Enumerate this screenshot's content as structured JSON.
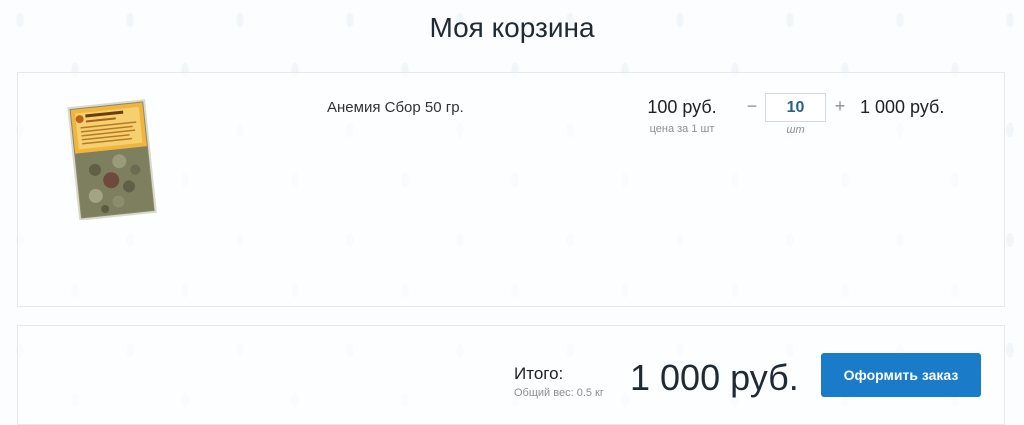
{
  "page": {
    "title": "Моя корзина"
  },
  "cart": {
    "items": [
      {
        "image_alt": "Анемия Сбор",
        "name": "Анемия Сбор 50 гр.",
        "unit_price": "100 руб.",
        "unit_price_caption": "цена за 1 шт",
        "quantity": "10",
        "quantity_unit": "шт",
        "minus_label": "−",
        "plus_label": "+",
        "line_total": "1 000 руб.",
        "package_label": "АНЕМИЯ"
      }
    ]
  },
  "summary": {
    "total_label": "Итого:",
    "total_weight": "Общий вес: 0.5 кг",
    "total_amount": "1 000 руб.",
    "checkout_label": "Оформить заказ"
  },
  "colors": {
    "accent": "#1a7bc9",
    "quantity_text": "#2a5f8f"
  }
}
